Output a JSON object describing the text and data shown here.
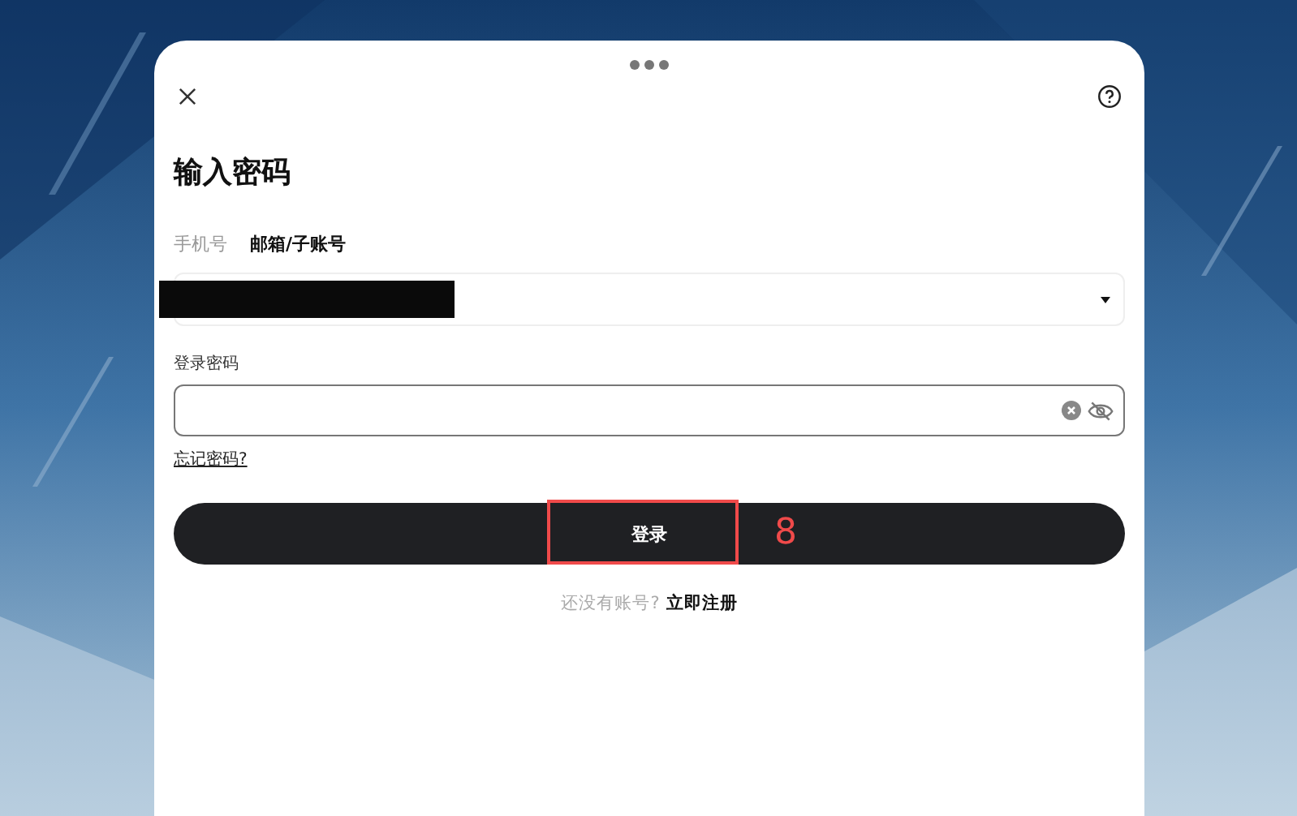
{
  "dialog": {
    "title": "输入密码"
  },
  "tabs": [
    {
      "label": "手机号",
      "selected": false
    },
    {
      "label": "邮箱/子账号",
      "selected": true
    }
  ],
  "account_field": {
    "redacted": true
  },
  "password": {
    "label": "登录密码",
    "visible": false
  },
  "forgot_link": "忘记密码?",
  "login_button": {
    "label": "登录",
    "annotation": "8"
  },
  "footer": {
    "text": "还没有账号?",
    "link": "立即注册"
  }
}
